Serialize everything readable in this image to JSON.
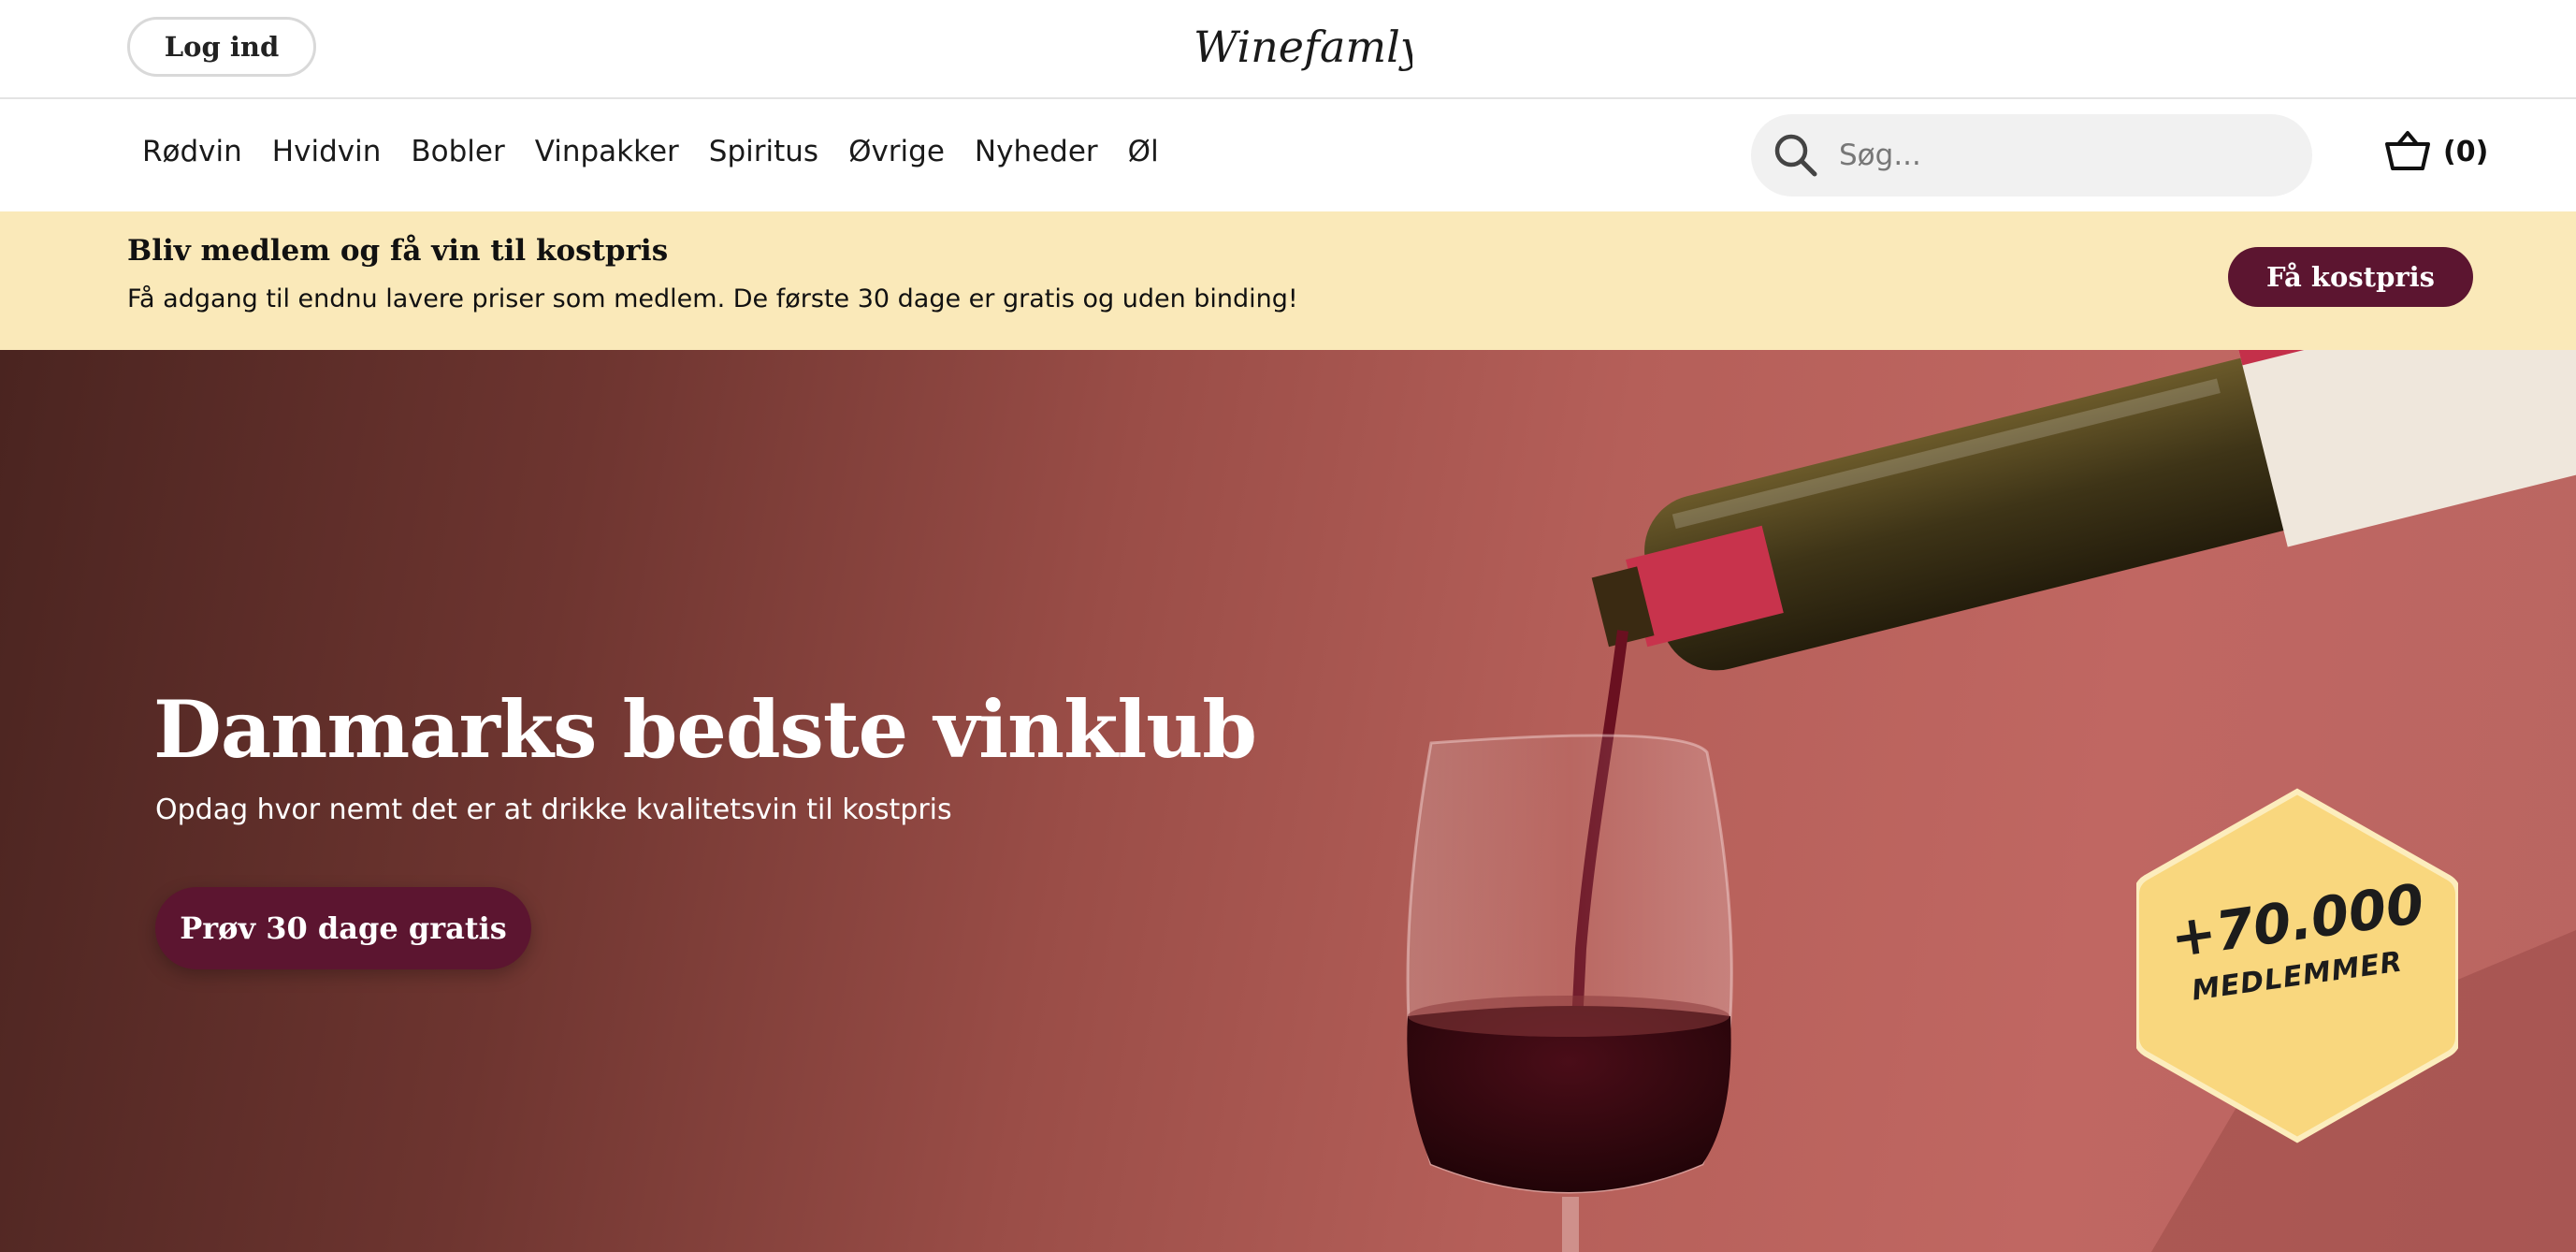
{
  "header": {
    "login_label": "Log ind",
    "logo_text": "Winefamly"
  },
  "nav": {
    "items": [
      {
        "label": "Rødvin"
      },
      {
        "label": "Hvidvin"
      },
      {
        "label": "Bobler"
      },
      {
        "label": "Vinpakker"
      },
      {
        "label": "Spiritus"
      },
      {
        "label": "Øvrige"
      },
      {
        "label": "Nyheder"
      },
      {
        "label": "Øl"
      }
    ],
    "search": {
      "placeholder": "Søg...",
      "value": "",
      "icon": "search-icon"
    },
    "cart": {
      "count": "(0)",
      "icon": "basket-icon"
    }
  },
  "promo": {
    "title": "Bliv medlem og få vin til kostpris",
    "text": "Få adgang til endnu lavere priser som medlem. De første 30 dage er gratis og uden binding!",
    "button_label": "Få kostpris"
  },
  "hero": {
    "title": "Danmarks bedste vinklub",
    "subtitle": "Opdag hvor nemt det er at drikke kvalitetsvin til kostpris",
    "button_label": "Prøv 30 dage gratis",
    "badge_count": "+70.000",
    "badge_label": "MEDLEMMER"
  },
  "colors": {
    "accent": "#5c1530",
    "promo_bg": "#fae9b9",
    "badge": "#f9d77e"
  }
}
